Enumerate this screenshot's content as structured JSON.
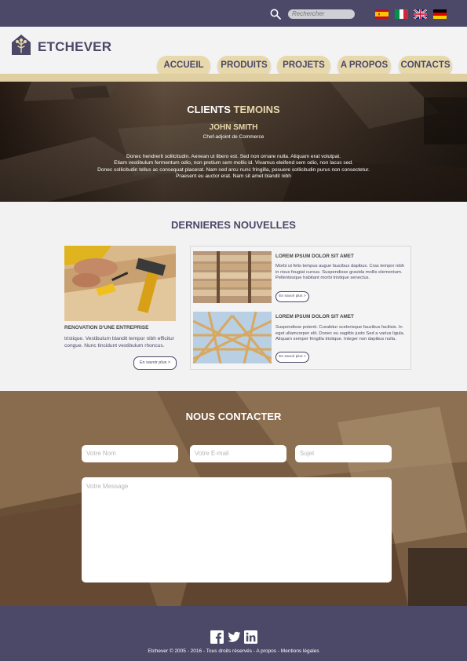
{
  "topbar": {
    "search_placeholder": "Rechercher",
    "languages": [
      "Español",
      "Italiano",
      "English",
      "Deutsch"
    ]
  },
  "header": {
    "brand": "ETCHEVER",
    "nav": [
      "ACCUEIL",
      "PRODUITS",
      "PROJETS",
      "A PROPOS",
      "CONTACTS"
    ]
  },
  "testimonials": {
    "title_part1": "CLIENTS",
    "title_part2": "TEMOINS",
    "name": "JOHN SMITH",
    "role": "Chef-adjoint de Commerce",
    "quote_lines": [
      "Donec hendrerit sollicitudin. Aenean ut libero est. Sed non ornare nulla. Aliquam erat volutpat.",
      "Etiam vestibulum fermentum odio, non pretium sem mollis id. Vivamus eleifend sem odio, non lacus sed.",
      "Donec sollicitudin tellus ac consequat placerat. Nam sed arcu nunc fringilla, posuere sollicitudin purus non consectetur.",
      "Praesent eu auctor erat. Nam sit amet blandit nibh"
    ]
  },
  "news": {
    "title": "DERNIERES NOUVELLES",
    "feature": {
      "title": "RENOVATION D'UNE ENTREPRISE",
      "text": "tristique. Vestibulum blandit tempor nibh efficitur congue. Nunc tincidunt vestibulum rhoncus.",
      "more": "En savoir plus >"
    },
    "items": [
      {
        "title": "LOREM IPSUM DOLOR SIT AMET",
        "text": "Morbi ut felis tempus augue faucibus dapibus. Cras tempor nibh in risus feugiat cursus. Suspendisse gravida mollis elementum. Pellentesque habitant morbi tristique senectus.",
        "more": "En savoir plus >"
      },
      {
        "title": "LOREM IPSUM DOLOR SIT AMET",
        "text": "Suspendisse potenti. Curabitur scelerisque faucibus facilisis. In eget ullamcorper elit. Donec eu sagittis justo Sed a varius ligula. Aliquam semper fringilla tristique. Integer non dapibus nulla.",
        "more": "En savoir plus >"
      }
    ]
  },
  "contact": {
    "title": "NOUS CONTACTER",
    "name_placeholder": "Votre Nom",
    "email_placeholder": "Votre E-mail",
    "subject_placeholder": "Sujet",
    "message_placeholder": "Votre Message"
  },
  "footer": {
    "copyright": "Etchever  ©  2005 - 2016 - Tous droits réservés - A propos - Mentions légales"
  },
  "colors": {
    "brand_purple": "#4b4868",
    "accent_beige": "#e8d9ad"
  }
}
